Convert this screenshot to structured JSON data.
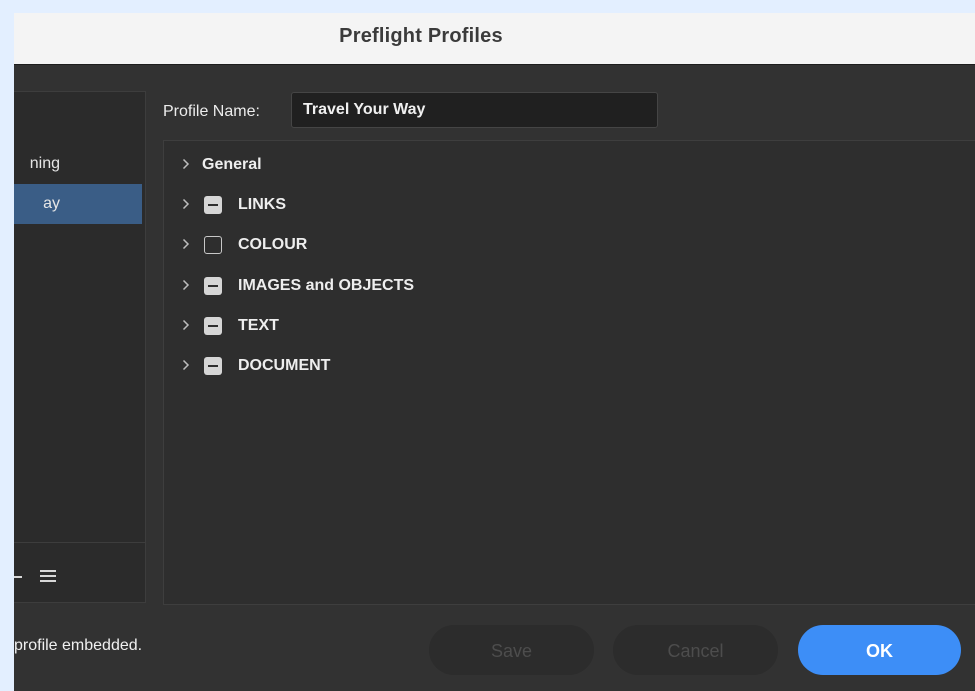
{
  "window": {
    "title": "Preflight Profiles"
  },
  "profiles": {
    "items": [
      {
        "label": "ning",
        "selected": false
      },
      {
        "label": "ay",
        "selected": true
      }
    ],
    "toolbar": {
      "remove_icon": "minus-icon",
      "menu_icon": "menu-icon"
    }
  },
  "profile_name": {
    "label": "Profile Name:",
    "value": "Travel Your Way"
  },
  "tree": {
    "rows": [
      {
        "label": "General",
        "checkbox": "none"
      },
      {
        "label": "LINKS",
        "checkbox": "mixed"
      },
      {
        "label": "COLOUR",
        "checkbox": "unchecked"
      },
      {
        "label": "IMAGES and OBJECTS",
        "checkbox": "mixed"
      },
      {
        "label": "TEXT",
        "checkbox": "mixed"
      },
      {
        "label": "DOCUMENT",
        "checkbox": "mixed"
      }
    ]
  },
  "footer": {
    "status": "profile embedded.",
    "save_label": "Save",
    "cancel_label": "Cancel",
    "ok_label": "OK"
  },
  "colors": {
    "accent": "#3d8ef7",
    "selection": "#3a5d86",
    "dialog_bg": "#323232"
  }
}
